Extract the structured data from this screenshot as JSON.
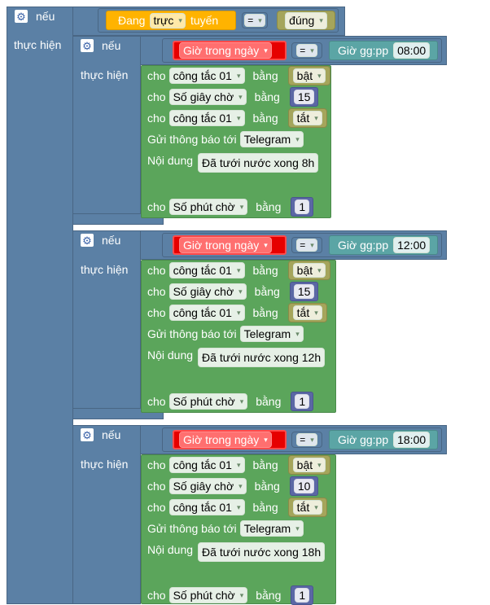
{
  "outer": {
    "if_label": "nếu",
    "do_label": "thực hiện",
    "condition": {
      "left": [
        "Đang",
        "trực",
        "tuyến"
      ],
      "op": "=",
      "right": "đúng"
    }
  },
  "colors": {
    "logic_blue": "#5b80a5",
    "action_green": "#5ba55b",
    "value_olive": "#a5a55b",
    "number_indigo": "#5b67a5",
    "time_teal": "#5ba5a5",
    "highlight_red": "#e60000",
    "device_yellow": "#ffb300"
  },
  "icons": {
    "gear": "gear-icon",
    "dropdown": "▾"
  },
  "blocks": [
    {
      "if_label": "nếu",
      "do_label": "thực hiện",
      "condition": {
        "left": "Giờ trong ngày",
        "op": "=",
        "time_label": "Giờ gg:pp",
        "time_value": "08:00"
      },
      "actions": {
        "row1": {
          "cho": "cho",
          "var": "công tắc 01",
          "bang": "bằng",
          "value": "bật"
        },
        "row2": {
          "cho": "cho",
          "var": "Số giây chờ",
          "bang": "bằng",
          "value": "15"
        },
        "row3": {
          "cho": "cho",
          "var": "công tắc 01",
          "bang": "bằng",
          "value": "tắt"
        },
        "notify": {
          "send_to": "Gửi thông báo tới",
          "channel": "Telegram",
          "content_label": "Nội dung",
          "content": "Đã tưới nước xong 8h"
        },
        "row4": {
          "cho": "cho",
          "var": "Số phút chờ",
          "bang": "bằng",
          "value": "1"
        }
      }
    },
    {
      "if_label": "nếu",
      "do_label": "thực hiện",
      "condition": {
        "left": "Giờ trong ngày",
        "op": "=",
        "time_label": "Giờ gg:pp",
        "time_value": "12:00"
      },
      "actions": {
        "row1": {
          "cho": "cho",
          "var": "công tắc 01",
          "bang": "bằng",
          "value": "bật"
        },
        "row2": {
          "cho": "cho",
          "var": "Số giây chờ",
          "bang": "bằng",
          "value": "15"
        },
        "row3": {
          "cho": "cho",
          "var": "công tắc 01",
          "bang": "bằng",
          "value": "tắt"
        },
        "notify": {
          "send_to": "Gửi thông báo tới",
          "channel": "Telegram",
          "content_label": "Nội dung",
          "content": "Đã tưới nước xong 12h"
        },
        "row4": {
          "cho": "cho",
          "var": "Số phút chờ",
          "bang": "bằng",
          "value": "1"
        }
      }
    },
    {
      "if_label": "nếu",
      "do_label": "thực hiện",
      "condition": {
        "left": "Giờ trong ngày",
        "op": "=",
        "time_label": "Giờ gg:pp",
        "time_value": "18:00"
      },
      "actions": {
        "row1": {
          "cho": "cho",
          "var": "công tắc 01",
          "bang": "bằng",
          "value": "bật"
        },
        "row2": {
          "cho": "cho",
          "var": "Số giây chờ",
          "bang": "bằng",
          "value": "10"
        },
        "row3": {
          "cho": "cho",
          "var": "công tắc 01",
          "bang": "bằng",
          "value": "tắt"
        },
        "notify": {
          "send_to": "Gửi thông báo tới",
          "channel": "Telegram",
          "content_label": "Nội dung",
          "content": "Đã tưới nước xong 18h"
        },
        "row4": {
          "cho": "cho",
          "var": "Số phút chờ",
          "bang": "bằng",
          "value": "1"
        }
      }
    }
  ]
}
